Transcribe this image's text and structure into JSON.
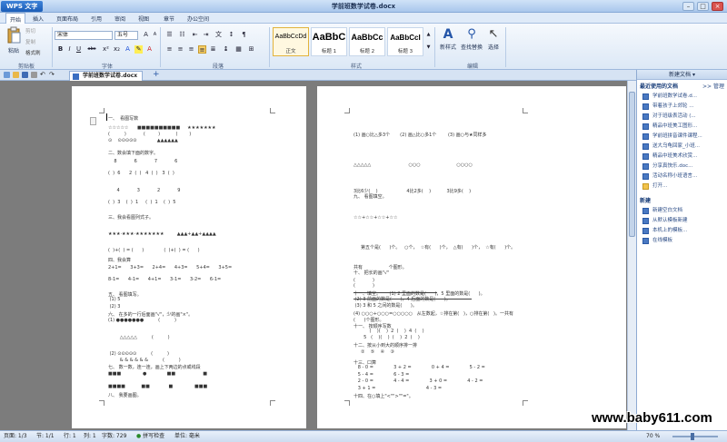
{
  "titlebar": {
    "app_name": "WPS 文字",
    "doc_title": "学前班数学试卷.docx",
    "minimize": "–",
    "restore": "□",
    "close": "×"
  },
  "menus": [
    "开始",
    "插入",
    "页面布局",
    "引用",
    "审阅",
    "视图",
    "章节",
    "办公空间"
  ],
  "toolbar": {
    "paste": "粘贴",
    "cut": "剪切",
    "copy": "复制",
    "format_painter": "格式刷",
    "font_name": "宋体",
    "font_size": "五号",
    "bold": "B",
    "italic": "I",
    "underline": "U",
    "strike": "abc",
    "new_style": "新样式",
    "find_replace": "查找替换",
    "select": "选择",
    "styles": [
      {
        "sample": "AaBbCcDd",
        "name": "正文"
      },
      {
        "sample": "AaBbC",
        "name": "标题 1"
      },
      {
        "sample": "AaBbCc",
        "name": "标题 2"
      },
      {
        "sample": "AaBbCcI",
        "name": "标题 3"
      }
    ],
    "group_labels": {
      "clipboard": "剪贴板",
      "font": "字体",
      "paragraph": "段落",
      "styles": "样式",
      "edit": "编辑"
    }
  },
  "tab": {
    "label": "学前班数学试卷.docx",
    "add": "+"
  },
  "page1": [
    "一、  看图写数",
    "☆☆☆☆☆      ■■■■■■■■■■     ★★★★★★★",
    "(          )            (         )           (        )",
    "⊙    ⊙⊙⊙⊙⊙              ▲▲▲▲▲▲",
    "二、数会填下面的数字。",
    "    8            6            7            6",
    "(  )  6      2  (  )   4  (  )   3  (  )",
    "      4            3            2            9",
    "(  )  3    (  )  1     (  )  1    (  )  5",
    "三、我会看图列式子。",
    "★★★·★★★·★★★★★★★         ▲▲▲+▲▲+▲▲▲▲",
    "(  )+(  ) = (      )              (  )+(  ) = (      )",
    "四、我会算",
    "2+1=      3+3=      2+4=      4+3=      5+4=      3+5=",
    "8-1=      4-1=      4+1=      3-1=      3-2=      6-1=",
    "五、 看图填写。",
    " (1) 5",
    " (2) 3",
    "六、 在多的一行后面画\"√\"，少的画\"×\"。",
    "(1) ●●●●●●●          (          )",
    "        △△△△△          (          )",
    " (2) ⊙⊙⊙⊙⊙          (          )",
    "        & & & & & &          (          )",
    "七、 数一数，连一连，画上下两边的点或线段",
    "■■■               ●              ■■                   ■",
    "■■■■           ■■             ■               ■■■",
    "八、 我要画图。"
  ],
  "page2": [
    "(1) 画○比△多3个       (2) 画△比○多1个        (3) 画○与★同样多",
    "△△△△△                          ○○○                         ○○○○",
    "九、 看图填空。",
    "3比6少(    )                    4比2多(    )           3比9多(    )",
    "☆☆+☆☆+☆☆+☆☆",
    "     第五个是(      )个。   ○个，  ☆有(      )个，  △有(      )个，  ☆有(      )个。",
    "共有                  个图形。",
    "十、 把长的画\"√\"",
    "(            )",
    "(            )",
    "十一、填空。      (1) 2 里面的数是(      )，5 里面的数是(      )。",
    " (2) 3 前面的数是(      )，4 后面的数是(      )。",
    " (3) 3 和 5 之间的数是(      )。",
    "(4) ○○○+○○○=○○○○○   从左数起，☆排在第(   )，○排在第(   )。一共有",
    "(      )个图形。",
    "十一、 按顺序写数",
    "           (    )(    )  2  (    )  4  (    )",
    "       5   (    )(    )  (    )  2  (    )",
    "十二、按从小到大的顺序排一排",
    "     ②    ⑤    ④    ③",
    "十三、口算",
    "   8 - 0 =              3 + 2 =              0 + 4 =              5 - 2 =",
    "   5 - 4 =              6 - 3 =",
    "   2 - 0 =              4 - 4 =              3 + 0 =              4 - 2 =",
    "   3 + 1 =                                   4 - 3 =",
    "十四、在○填上\"<\"\">\"\"=\"。"
  ],
  "taskpane": {
    "header": "新建文档 ▾",
    "recent_title": "最近使用的文档",
    "manage": ">> 管理",
    "recent": [
      "学前班数学试卷.d...",
      "带着孩子上郊轮 ...",
      "对于班级表活动 (...",
      "精品中班美工图形...",
      "学前班拼音课件课程...",
      "送大乌龟回家_小班...",
      "精品中班美术欣赏...",
      "分享真快乐.doc...",
      "活动名称小班语言..."
    ],
    "open": "打开...",
    "new_title": "新建",
    "new_items": [
      "新建空白文档",
      "从默认模板新建",
      "本机上的模板...",
      "在线模板"
    ]
  },
  "status": {
    "page": "页面: 1/3",
    "section": "节: 1/1",
    "row": "行: 1",
    "col": "列: 1",
    "words": "字数: 729",
    "spell": "拼写检查",
    "unit": "单位: 毫米",
    "zoom": "70 %"
  },
  "watermark": "www.baby611.com"
}
